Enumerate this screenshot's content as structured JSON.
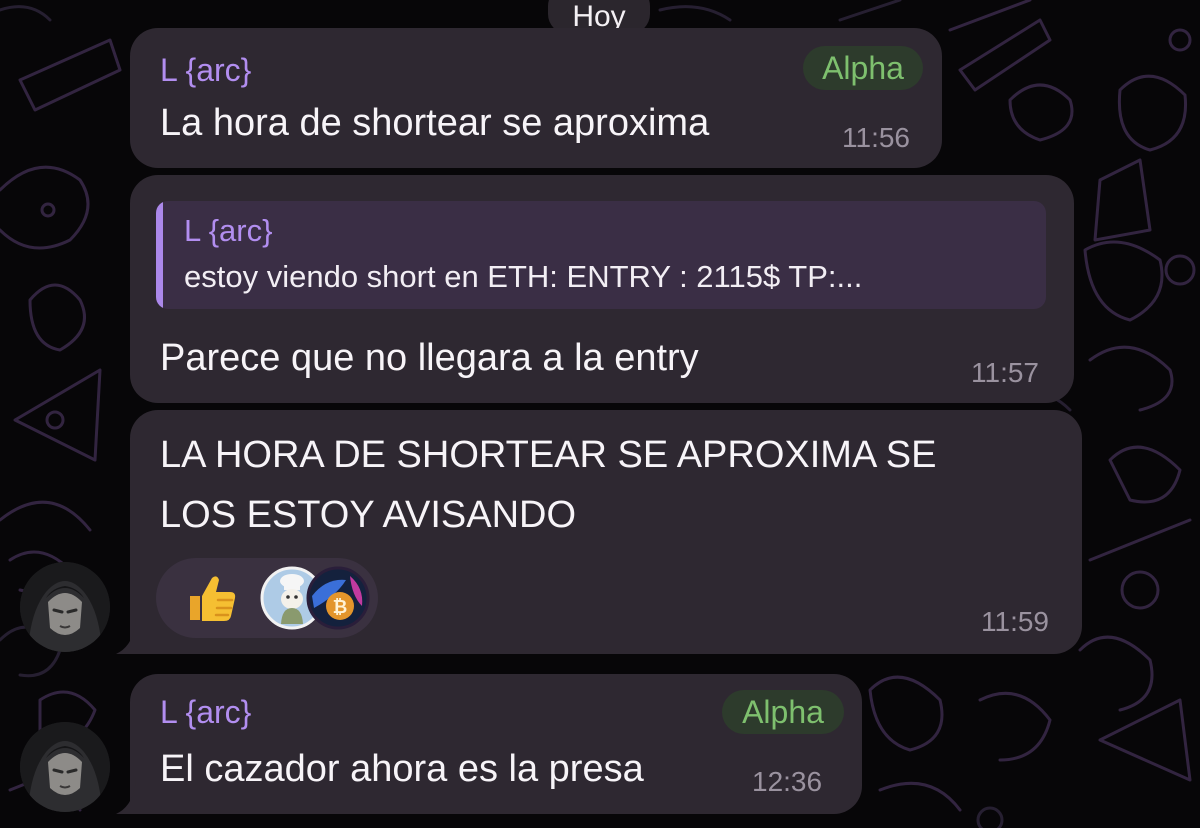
{
  "date_separator": "Hoy",
  "messages": [
    {
      "sender": "L {arc}",
      "role": "Alpha",
      "text": "La hora de shortear se aproxima",
      "time": "11:56"
    },
    {
      "reply": {
        "sender": "L {arc}",
        "text": "estoy viendo short en ETH: ENTRY : 2115$ TP:..."
      },
      "text": "Parece que no llegara a la entry",
      "time": "11:57"
    },
    {
      "text_lines": [
        "LA HORA DE SHORTEAR SE APROXIMA SE",
        "LOS ESTOY AVISANDO"
      ],
      "time": "11:59",
      "reactions": [
        "thumbs-up-emoji",
        "reactor-avatar-chef",
        "reactor-avatar-bitcoin"
      ]
    },
    {
      "sender": "L {arc}",
      "role": "Alpha",
      "text": "El cazador ahora es la presa",
      "time": "12:36"
    }
  ],
  "colors": {
    "background": "#070608",
    "bubble": "#2e2831",
    "sender": "#b28ef0",
    "role_text": "#7ec06e",
    "role_bg": "#2d3b2c",
    "time": "#9a929f",
    "quote_bg": "#3a2e45",
    "quote_bar": "#ab88ea"
  }
}
